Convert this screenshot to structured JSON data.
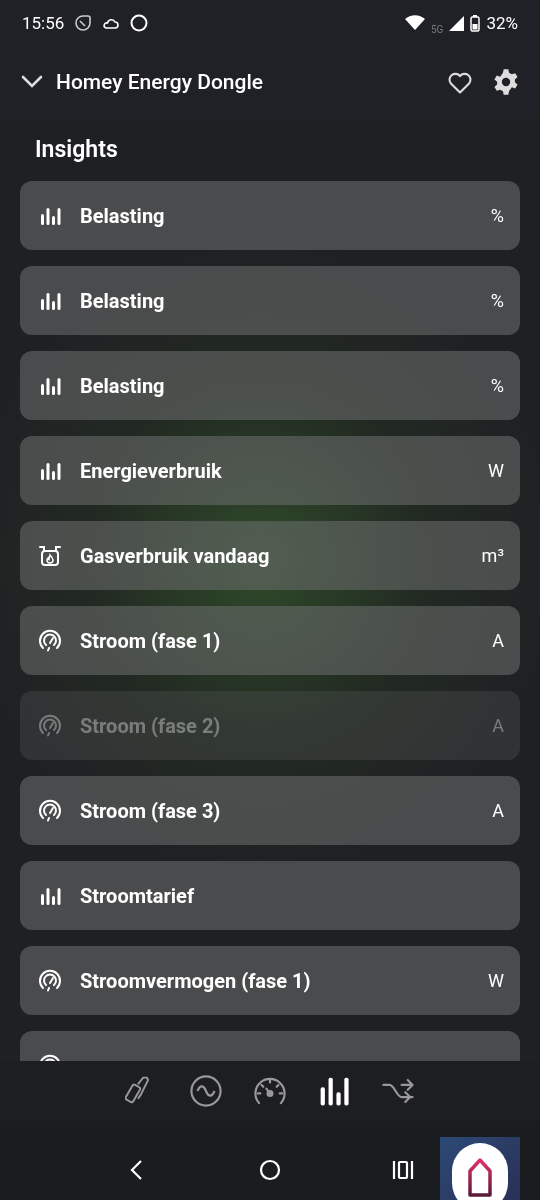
{
  "status_bar": {
    "time": "15:56",
    "network": "5G",
    "battery": "32%"
  },
  "header": {
    "title": "Homey Energy Dongle"
  },
  "section_title": "Insights",
  "insights": [
    {
      "kind": "bars",
      "label": "Belasting",
      "unit": "%",
      "disabled": false
    },
    {
      "kind": "bars",
      "label": "Belasting",
      "unit": "%",
      "disabled": false
    },
    {
      "kind": "bars",
      "label": "Belasting",
      "unit": "%",
      "disabled": false
    },
    {
      "kind": "bars",
      "label": "Energieverbruik",
      "unit": "W",
      "disabled": false
    },
    {
      "kind": "gas",
      "label": "Gasverbruik vandaag",
      "unit": "m³",
      "disabled": false
    },
    {
      "kind": "gauge",
      "label": "Stroom (fase 1)",
      "unit": "A",
      "disabled": false
    },
    {
      "kind": "gauge",
      "label": "Stroom (fase 2)",
      "unit": "A",
      "disabled": true
    },
    {
      "kind": "gauge",
      "label": "Stroom (fase 3)",
      "unit": "A",
      "disabled": false
    },
    {
      "kind": "bars",
      "label": "Stroomtarief",
      "disabled": false
    },
    {
      "kind": "gauge",
      "label": "Stroomvermogen (fase 1)",
      "unit": "W",
      "disabled": false
    },
    {
      "kind": "gauge",
      "disabled": false
    }
  ],
  "bottom_tabs": [
    {
      "kind": "device",
      "selected": false
    },
    {
      "kind": "wave",
      "selected": false
    },
    {
      "kind": "gauge",
      "selected": false
    },
    {
      "kind": "insights",
      "selected": true
    },
    {
      "kind": "flow",
      "selected": false
    }
  ]
}
